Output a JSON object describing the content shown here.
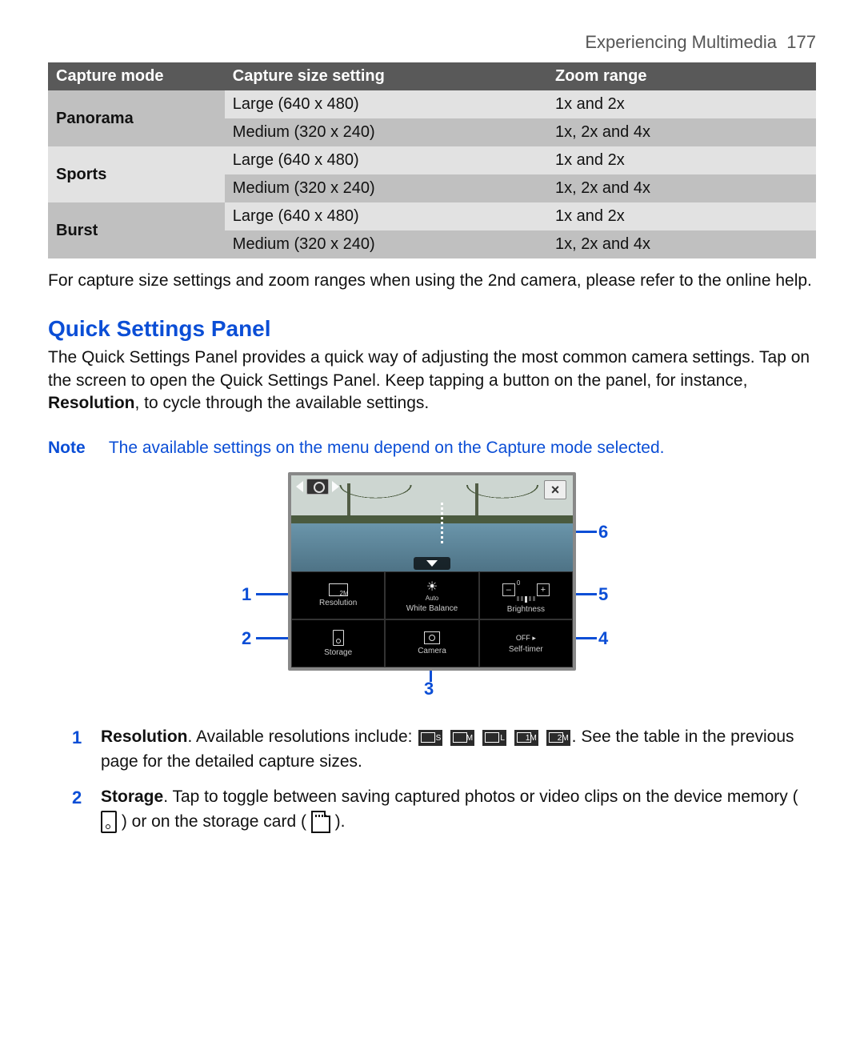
{
  "header": {
    "chapter": "Experiencing Multimedia",
    "page": "177"
  },
  "table": {
    "columns": [
      "Capture mode",
      "Capture size setting",
      "Zoom range"
    ],
    "modes": [
      {
        "name": "Panorama",
        "rows": [
          {
            "size": "Large (640 x 480)",
            "zoom": "1x and 2x"
          },
          {
            "size": "Medium (320 x 240)",
            "zoom": "1x, 2x and 4x"
          }
        ]
      },
      {
        "name": "Sports",
        "rows": [
          {
            "size": "Large (640 x 480)",
            "zoom": "1x and 2x"
          },
          {
            "size": "Medium (320 x 240)",
            "zoom": "1x, 2x and 4x"
          }
        ]
      },
      {
        "name": "Burst",
        "rows": [
          {
            "size": "Large (640 x 480)",
            "zoom": "1x and 2x"
          },
          {
            "size": "Medium (320 x 240)",
            "zoom": "1x, 2x and 4x"
          }
        ]
      }
    ]
  },
  "para_after_table": "For capture size settings and zoom ranges when using the 2nd camera, please refer to the online help.",
  "section_title": "Quick Settings Panel",
  "section_body_a": "The Quick Settings Panel provides a quick way of adjusting the most common camera settings. Tap on the screen to open the Quick Settings Panel. Keep tapping a button on the panel, for instance, ",
  "section_body_bold": "Resolution",
  "section_body_b": ", to cycle through the available settings.",
  "note_label": "Note",
  "note_text": "The available settings on the menu depend on the Capture mode selected.",
  "panel": {
    "res_value": "2M",
    "wb_value": "Auto",
    "brightness_value": "0",
    "selftimer_value": "OFF",
    "labels": {
      "resolution": "Resolution",
      "white_balance": "White Balance",
      "brightness": "Brightness",
      "storage": "Storage",
      "camera": "Camera",
      "selftimer": "Self-timer"
    }
  },
  "callouts": [
    "1",
    "2",
    "3",
    "4",
    "5",
    "6"
  ],
  "list": {
    "item1_bold": "Resolution",
    "item1_a": ". Available resolutions include: ",
    "item1_icons": [
      "S",
      "M",
      "L",
      "1M",
      "2M"
    ],
    "item1_b": " See the table in the previous page for the detailed capture sizes.",
    "item2_bold": "Storage",
    "item2_a": ". Tap to toggle between saving captured photos or video clips on the device memory ( ",
    "item2_b": " ) or on the storage card ( ",
    "item2_c": " )."
  }
}
